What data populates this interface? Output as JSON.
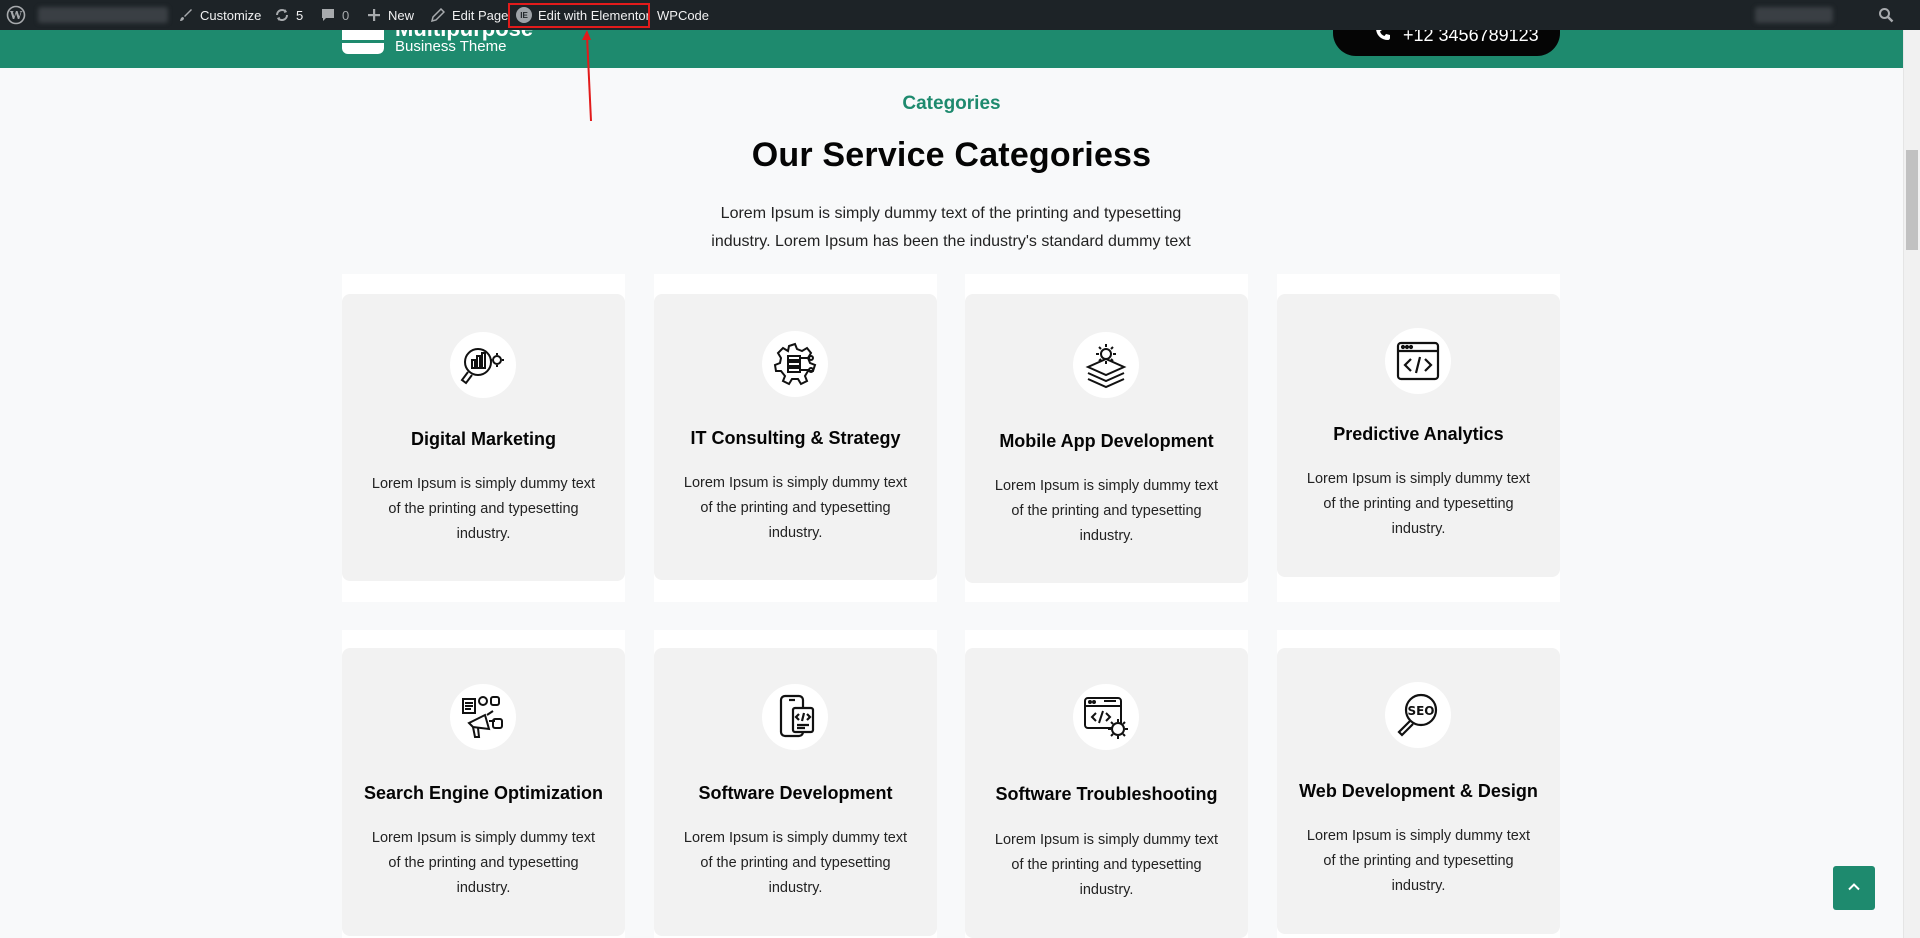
{
  "admin_bar": {
    "customize_label": "Customize",
    "updates_count": "5",
    "comments_count": "0",
    "new_label": "New",
    "edit_page_label": "Edit Page",
    "edit_elementor_label": "Edit with Elementor",
    "wpcode_label": "WPCode"
  },
  "header": {
    "logo_title": "Multipurpose",
    "logo_subtitle": "Business Theme",
    "phone": "+12 3456789123"
  },
  "section": {
    "eyebrow": "Categories",
    "heading": "Our Service Categoriess",
    "intro": "Lorem Ipsum is simply dummy text of the printing and typesetting industry. Lorem Ipsum has been the industry's standard dummy text"
  },
  "cards": [
    {
      "title": "Digital Marketing",
      "desc": "Lorem Ipsum is simply dummy text of the printing and typesetting industry.",
      "icon": "digital-marketing-icon"
    },
    {
      "title": "IT Consulting & Strategy",
      "desc": "Lorem Ipsum is simply dummy text of the printing and typesetting industry.",
      "icon": "it-consulting-icon"
    },
    {
      "title": "Mobile App Development",
      "desc": "Lorem Ipsum is simply dummy text of the printing and typesetting industry.",
      "icon": "mobile-app-icon"
    },
    {
      "title": "Predictive Analytics",
      "desc": "Lorem Ipsum is simply dummy text of the printing and typesetting industry.",
      "icon": "code-window-icon"
    },
    {
      "title": "Search Engine Optimization",
      "desc": "Lorem Ipsum is simply dummy text of the printing and typesetting industry.",
      "icon": "megaphone-icon"
    },
    {
      "title": "Software Development",
      "desc": "Lorem Ipsum is simply dummy text of the printing and typesetting industry.",
      "icon": "mobile-code-icon"
    },
    {
      "title": "Software Troubleshooting",
      "desc": "Lorem Ipsum is simply dummy text of the printing and typesetting industry.",
      "icon": "browser-gear-icon"
    },
    {
      "title": "Web Development & Design",
      "desc": "Lorem Ipsum is simply dummy text of the printing and typesetting industry.",
      "icon": "seo-magnifier-icon"
    }
  ],
  "colors": {
    "brand_green": "#1e8a6e",
    "admin_bar": "#1d2327",
    "highlight_red": "#e21b1b"
  }
}
